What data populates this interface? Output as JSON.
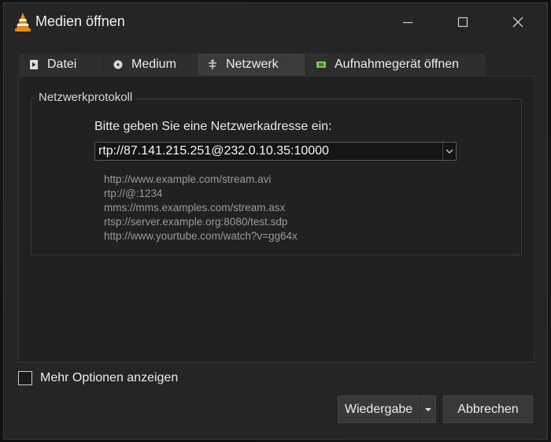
{
  "window": {
    "title": "Medien öffnen",
    "controls": {
      "minimize": "minimize",
      "maximize": "maximize",
      "close": "close"
    }
  },
  "tabs": [
    {
      "label": "Datei",
      "icon": "file-icon",
      "active": false
    },
    {
      "label": "Medium",
      "icon": "disc-icon",
      "active": false
    },
    {
      "label": "Netzwerk",
      "icon": "network-icon",
      "active": true
    },
    {
      "label": "Aufnahmegerät öffnen",
      "icon": "capture-device-icon",
      "active": false
    }
  ],
  "network": {
    "group_title": "Netzwerkprotokoll",
    "prompt": "Bitte geben Sie eine Netzwerkadresse ein:",
    "url_value": "rtp://87.141.215.251@232.0.10.35:10000",
    "examples": [
      "http://www.example.com/stream.avi",
      "rtp://@:1234",
      "mms://mms.examples.com/stream.asx",
      "rtsp://server.example.org:8080/test.sdp",
      "http://www.yourtube.com/watch?v=gg64x"
    ]
  },
  "footer": {
    "more_options_label": "Mehr Optionen anzeigen",
    "more_options_checked": false,
    "play_label": "Wiedergabe",
    "cancel_label": "Abbrechen"
  },
  "colors": {
    "window_bg": "#252525",
    "active_tab": "#3b3b3b",
    "vlc_orange": "#f08a00"
  }
}
